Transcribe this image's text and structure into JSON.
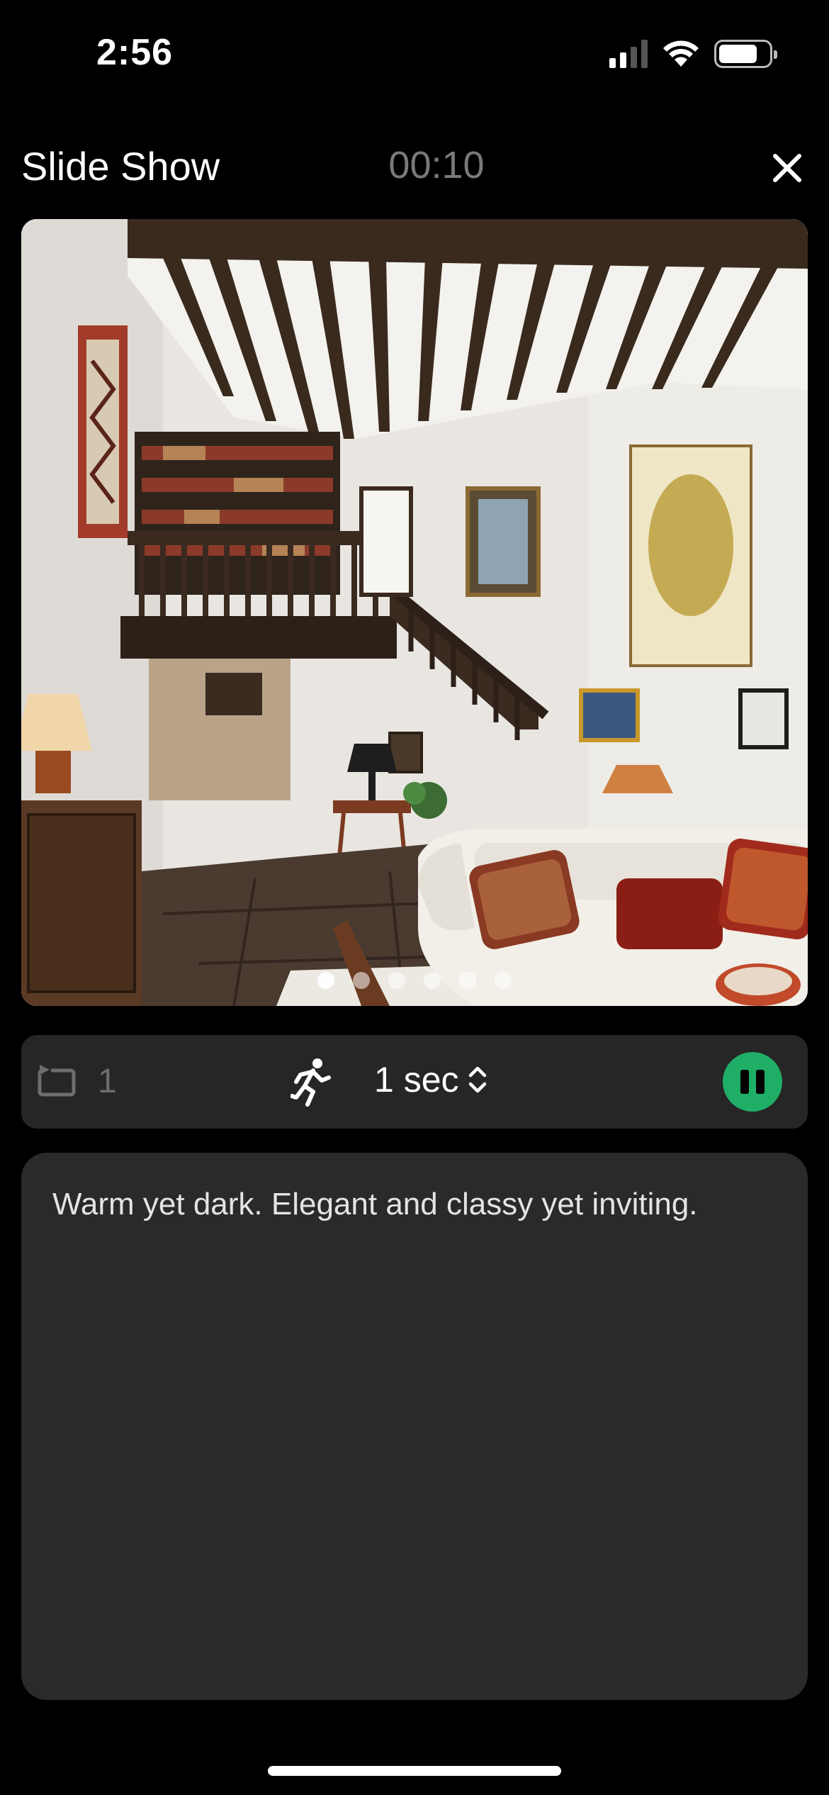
{
  "status_bar": {
    "time": "2:56",
    "icons": [
      "signal-icon",
      "wifi-icon",
      "battery-icon"
    ]
  },
  "header": {
    "title": "Slide Show",
    "timer": "00:10",
    "close_icon": "close-icon"
  },
  "slide": {
    "image_description": "living-room-photo",
    "dot_count": 6,
    "active_dot": 0
  },
  "controls": {
    "loop_icon": "repeat-icon",
    "loop_count": "1",
    "speed_icon": "running-person-icon",
    "interval": "1 sec",
    "interval_icon": "chevron-up-down-icon",
    "play_state_icon": "pause-icon"
  },
  "caption": {
    "text": "Warm yet dark. Elegant and classy yet inviting."
  },
  "colors": {
    "accent": "#1fae66",
    "panel": "#262626",
    "background": "#000000"
  }
}
